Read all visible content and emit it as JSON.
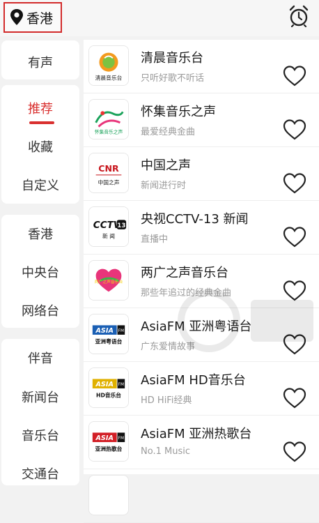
{
  "location": {
    "city": "香港"
  },
  "sidebar": {
    "groups": [
      {
        "items": [
          "有声"
        ]
      },
      {
        "items": [
          "推荐",
          "收藏",
          "自定义"
        ]
      },
      {
        "items": [
          "香港",
          "中央台",
          "网络台"
        ]
      },
      {
        "items": [
          "伴音",
          "新闻台",
          "音乐台",
          "交通台"
        ]
      }
    ],
    "active": "推荐"
  },
  "stations": [
    {
      "title": "清晨音乐台",
      "subtitle": "只听好歌不听话",
      "logo_text": "清晨音乐台"
    },
    {
      "title": "怀集音乐之声",
      "subtitle": "最爱经典金曲",
      "logo_text": "怀集音乐之声"
    },
    {
      "title": "中国之声",
      "subtitle": "新闻进行时",
      "logo_text": "中国之声",
      "logo_brand": "CNR"
    },
    {
      "title": "央视CCTV-13 新闻",
      "subtitle": "直播中",
      "logo_brand": "CCTV",
      "logo_num": "13",
      "logo_text": "新 闻"
    },
    {
      "title": "两广之声音乐台",
      "subtitle": "那些年追过的经典金曲",
      "logo_text": "两广之声音乐台"
    },
    {
      "title": "AsiaFM 亚洲粤语台",
      "subtitle": "广东爱情故事",
      "logo_brand": "ASIA",
      "logo_fm": "FM",
      "logo_text": "亚洲粤语台"
    },
    {
      "title": "AsiaFM HD音乐台",
      "subtitle": "HD HiFi经典",
      "logo_brand": "ASIA",
      "logo_fm": "FM",
      "logo_text": "HD音乐台"
    },
    {
      "title": "AsiaFM 亚洲热歌台",
      "subtitle": "No.1 Music",
      "logo_brand": "ASIA",
      "logo_fm": "FM",
      "logo_text": "亚洲热歌台"
    }
  ],
  "colors": {
    "accent": "#d9302f",
    "background": "#f2f2f2"
  }
}
